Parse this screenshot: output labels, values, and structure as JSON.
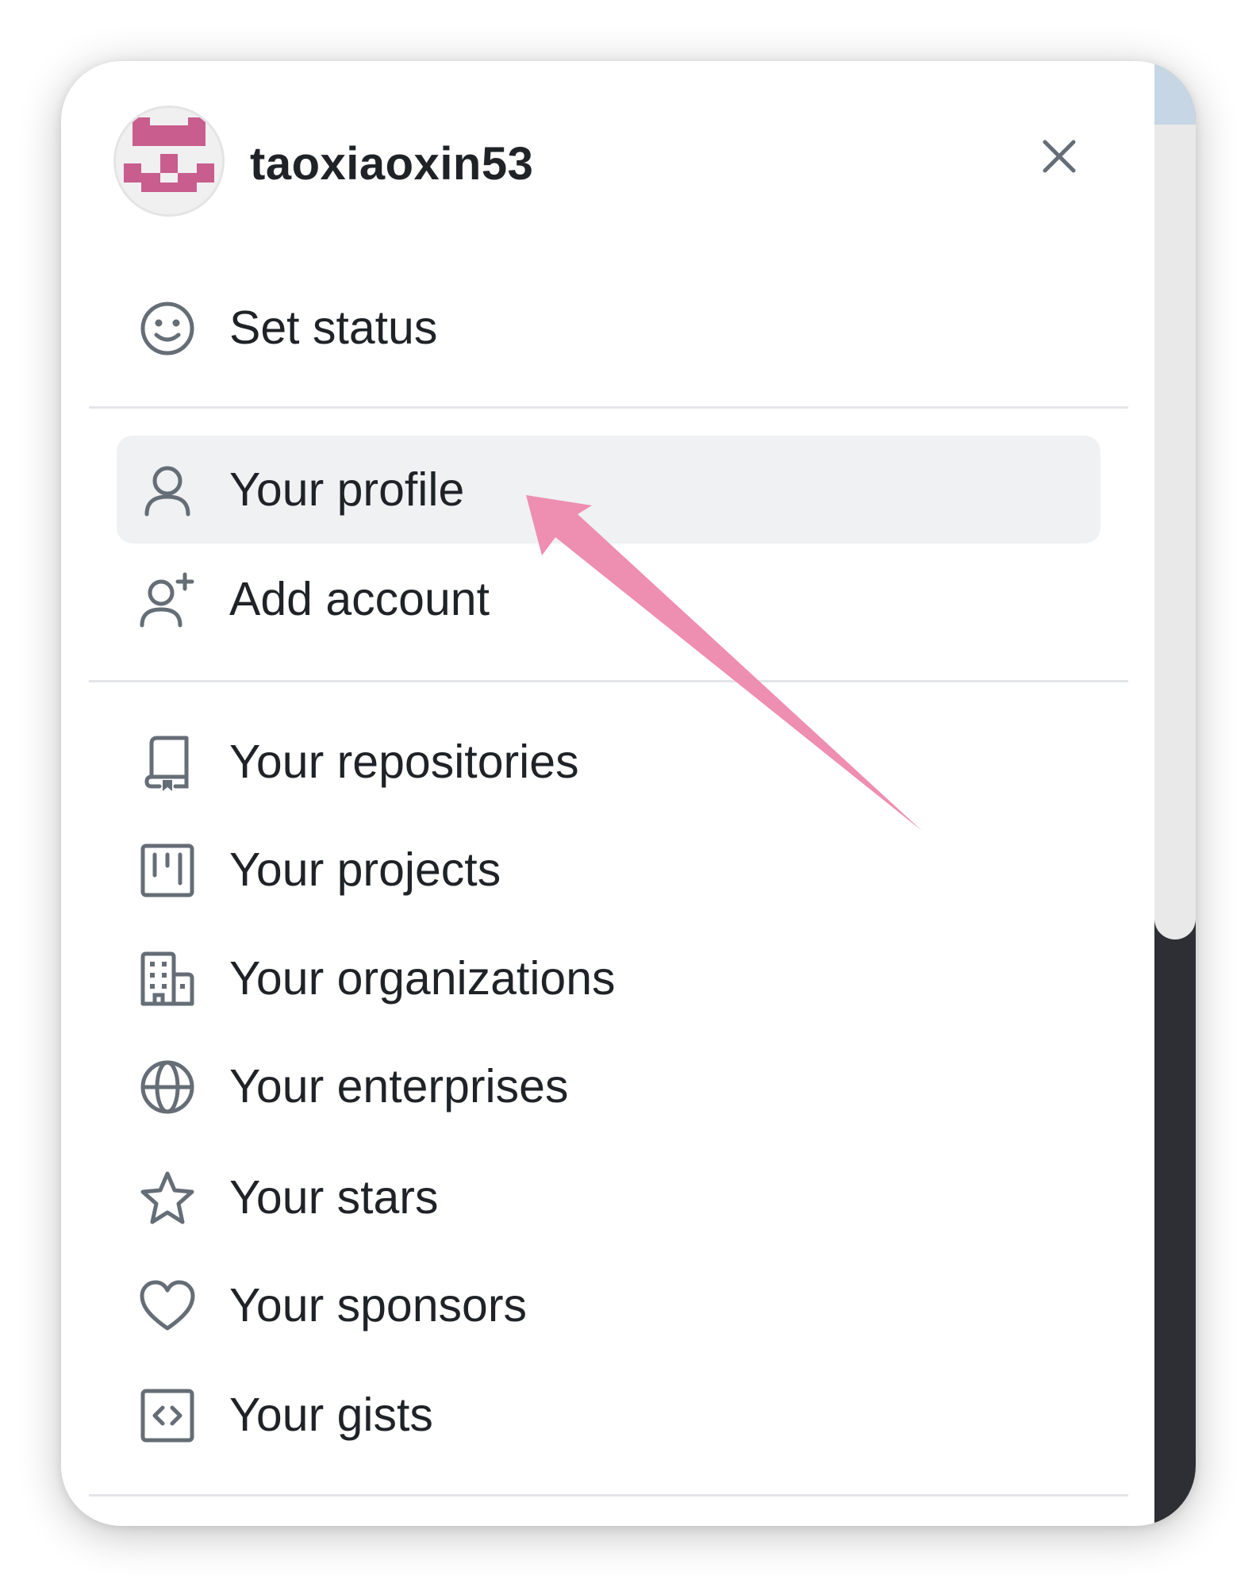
{
  "user": {
    "username": "taoxiaoxin53",
    "avatar_icon": "identicon-avatar",
    "avatar_color": "#c85d8e"
  },
  "close": {
    "icon": "close-icon"
  },
  "menu": {
    "status": {
      "label": "Set status",
      "icon": "smiley-icon"
    },
    "profile": {
      "label": "Your profile",
      "icon": "person-icon",
      "highlighted": true
    },
    "add_account": {
      "label": "Add account",
      "icon": "person-add-icon"
    },
    "repositories": {
      "label": "Your repositories",
      "icon": "repo-icon"
    },
    "projects": {
      "label": "Your projects",
      "icon": "project-icon"
    },
    "organizations": {
      "label": "Your organizations",
      "icon": "organization-icon"
    },
    "enterprises": {
      "label": "Your enterprises",
      "icon": "globe-icon"
    },
    "stars": {
      "label": "Your stars",
      "icon": "star-icon"
    },
    "sponsors": {
      "label": "Your sponsors",
      "icon": "heart-icon"
    },
    "gists": {
      "label": "Your gists",
      "icon": "code-square-icon"
    }
  },
  "annotation": {
    "arrow_color": "#ee8eb0",
    "target": "Your profile"
  },
  "colors": {
    "text": "#1f2328",
    "icon": "#656d76",
    "highlight": "#eff1f3",
    "divider": "#e3e5e8"
  }
}
